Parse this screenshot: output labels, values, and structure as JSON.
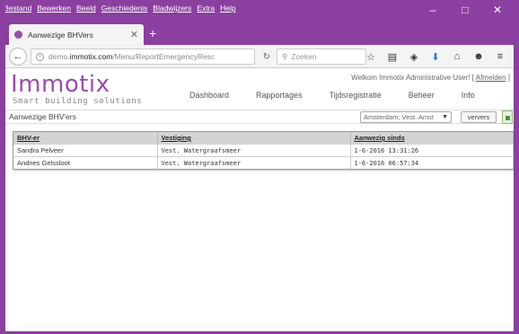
{
  "menu": [
    "Bestand",
    "Bewerken",
    "Beeld",
    "Geschiedenis",
    "Bladwijzers",
    "Extra",
    "Help"
  ],
  "window_controls": {
    "minimize": "–",
    "maximize": "□",
    "close": "✕"
  },
  "tab": {
    "title": "Aanwezige BHVers",
    "close": "✕",
    "new_tab": "+"
  },
  "address": {
    "prefix": "demo.",
    "host": "immotix.com",
    "path": "/Menu/ReportEmergencyResc",
    "search_placeholder": "Zoeken"
  },
  "app": {
    "logo_text": "Immotix",
    "tagline": "Smart building solutions",
    "welcome_text": "Welkom Immotix Administrative User! [",
    "logout_label": "Afmelden",
    "welcome_suffix": " ]",
    "nav": [
      "Dashboard",
      "Rapportages",
      "Tijdsregistratie",
      "Beheer",
      "Info"
    ]
  },
  "page": {
    "title": "Aanwezige BHV'ers",
    "location_value": "Amsterdam; Vest. Amst",
    "refresh_label": "ververs"
  },
  "grid": {
    "columns": [
      "BHV-er",
      "Vestiging",
      "Aanwezig sinds"
    ],
    "rows": [
      [
        "Sandra Pelveer",
        "Vest. Watergraafsmeer",
        "1-6-2016 13:31:26"
      ],
      [
        "Andnes Gelssloot",
        "Vest. Watergraafsmeer",
        "1-6-2016 06:57:34"
      ]
    ]
  },
  "colors": {
    "frame": "#8b3fa0",
    "brand": "#9b4bb0"
  }
}
